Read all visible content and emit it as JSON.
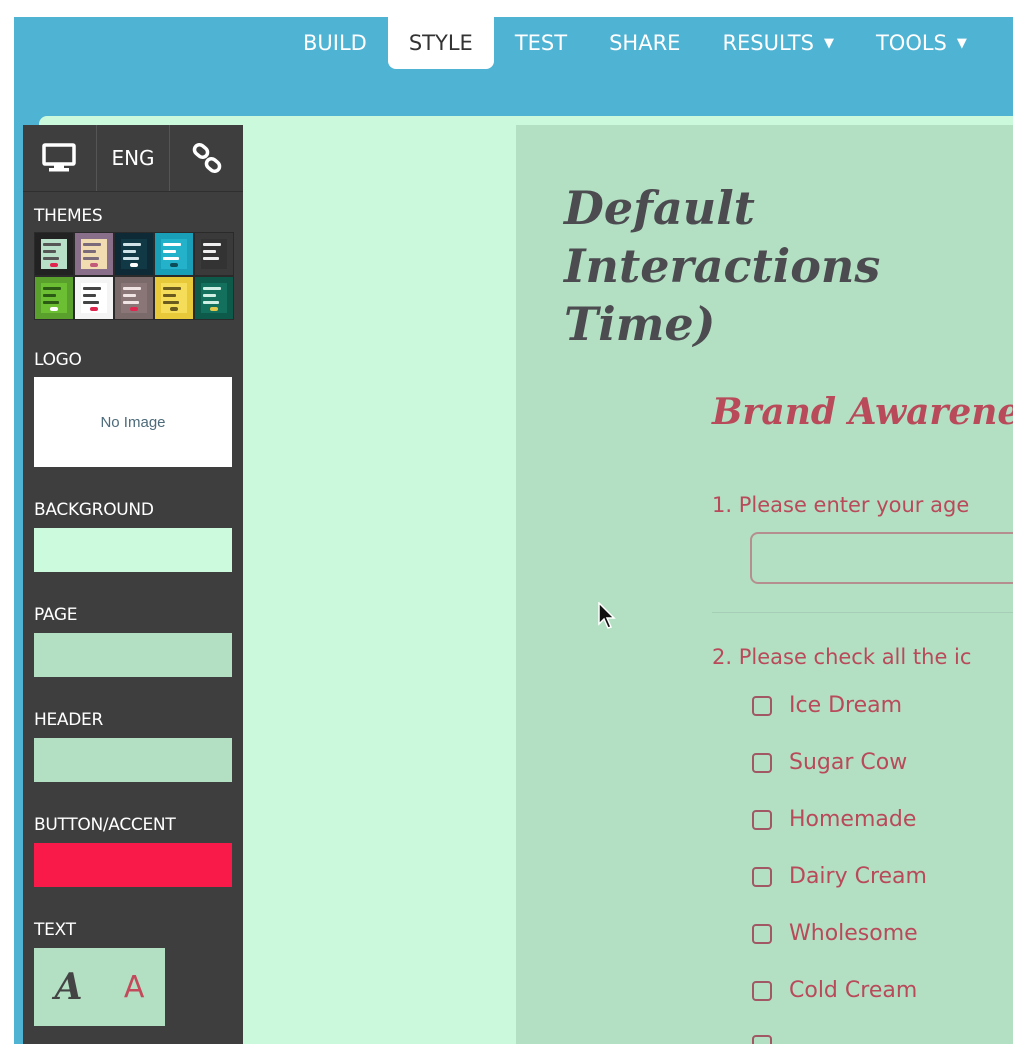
{
  "nav": {
    "tabs": [
      {
        "label": "BUILD",
        "caret": ""
      },
      {
        "label": "STYLE",
        "caret": ""
      },
      {
        "label": "TEST",
        "caret": ""
      },
      {
        "label": "SHARE",
        "caret": ""
      },
      {
        "label": "RESULTS",
        "caret": "▼"
      },
      {
        "label": "TOOLS",
        "caret": "▼"
      }
    ],
    "active_tab": "STYLE"
  },
  "sidebar": {
    "tools": {
      "desktop_icon": "monitor-icon",
      "language_label": "ENG",
      "link_icon": "link-icon"
    },
    "themes_label": "THEMES",
    "logo_label": "LOGO",
    "logo_placeholder": "No Image",
    "background_label": "BACKGROUND",
    "background_color": "#ccfadc",
    "page_label": "PAGE",
    "page_color": "#b3dfc3",
    "header_label": "HEADER",
    "header_color": "#b3dfc3",
    "accent_label": "BUTTON/ACCENT",
    "accent_color": "#fa1a49",
    "text_label": "TEXT",
    "text_font_script": "A",
    "text_font_sans": "A"
  },
  "survey": {
    "title": "Default Interactions\nTime)",
    "section_title": "Brand Awareness",
    "q1": "1. Please enter your age",
    "q2": "2. Please check all the ic",
    "options": [
      "Ice Dream",
      "Sugar Cow",
      "Homemade",
      "Dairy Cream",
      "Wholesome",
      "Cold Cream"
    ]
  },
  "colors": {
    "frame": "#4fb3d4",
    "sidebar": "#3e3e3e",
    "survey_text": "#b84a5a",
    "title_text": "#4b4b50"
  }
}
